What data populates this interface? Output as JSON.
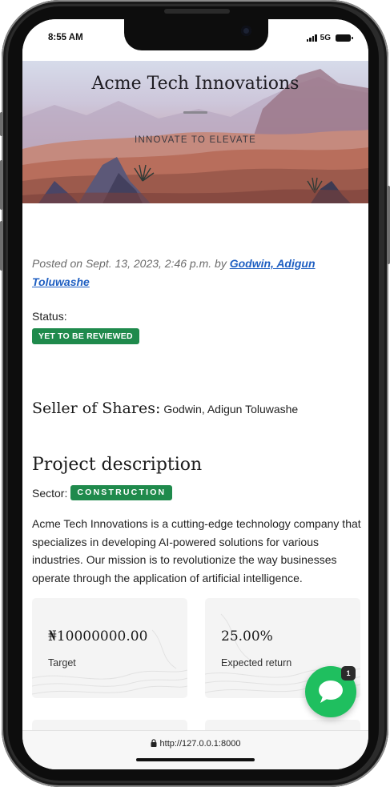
{
  "status_bar": {
    "time": "8:55 AM",
    "network": "5G"
  },
  "hero": {
    "title": "Acme Tech Innovations",
    "tagline": "INNOVATE TO ELEVATE"
  },
  "post": {
    "posted_prefix": "Posted on Sept. 13, 2023, 2:46 p.m. by ",
    "author_line1": "Godwin, Adigun",
    "author_line2": "Toluwashe"
  },
  "status": {
    "label": "Status:",
    "badge": "YET TO BE REVIEWED",
    "badge_color": "#1f8a4c"
  },
  "seller": {
    "heading": "Seller of Shares:",
    "name": "Godwin, Adigun Toluwashe"
  },
  "project": {
    "heading": "Project description",
    "sector_label": "Sector:",
    "sector": "CONSTRUCTION",
    "description": "Acme Tech Innovations is a cutting-edge technology company that specializes in developing AI-powered solutions for various industries. Our mission is to revolutionize the way businesses operate through the application of artificial intelligence."
  },
  "cards": [
    {
      "value": "₦10000000.00",
      "label": "Target"
    },
    {
      "value": "25.00%",
      "label": "Expected return"
    }
  ],
  "chat": {
    "icon": "chat-bubble-icon",
    "count": "1",
    "color": "#1fbf5f"
  },
  "browser": {
    "url": "http://127.0.0.1:8000"
  }
}
